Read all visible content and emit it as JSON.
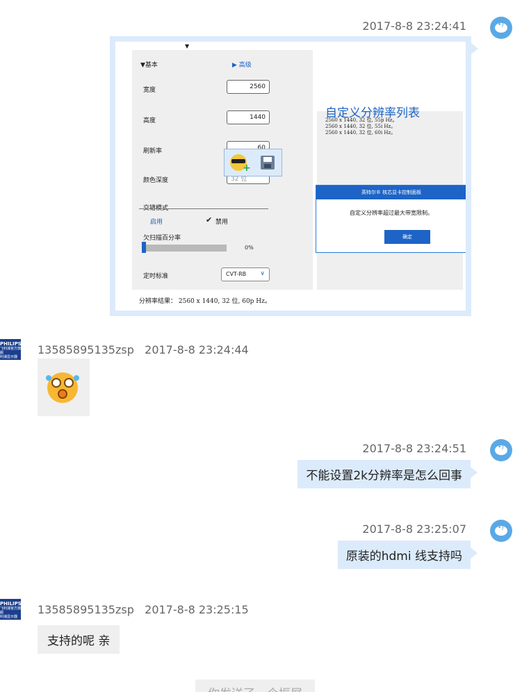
{
  "messages": [
    {
      "time": "2017-8-8 23:24:41"
    },
    {
      "sender": "13585895135zsp",
      "time": "2017-8-8 23:24:44"
    },
    {
      "time": "2017-8-8 23:24:51",
      "text": "不能设置2k分辨率是怎么回事"
    },
    {
      "time": "2017-8-8 23:25:07",
      "text": "原装的hdmi 线支持吗"
    },
    {
      "sender": "13585895135zsp",
      "time": "2017-8-8 23:25:15",
      "text": "支持的呢 亲"
    }
  ],
  "other_avatar": {
    "brand": "PHILIPS",
    "line1": "飞利浦官方旗舰",
    "line2": "利浦显示器"
  },
  "screenshot": {
    "tab_basic": "基本",
    "tab_advanced": "高级",
    "width_label": "宽度",
    "width_value": "2560",
    "height_label": "高度",
    "height_value": "1440",
    "refresh_label": "刷新率",
    "refresh_value": "60",
    "color_depth_label": "颜色深度",
    "color_depth_value": "32 位",
    "interlace_label": "交错模式",
    "interlace_on": "启用",
    "interlace_off": "禁用",
    "underscan_label": "欠扫描百分率",
    "underscan_value": "0%",
    "timing_label": "定时标准",
    "timing_value": "CVT-RB",
    "result": "分辨率结果： 2560 x 1440, 32 位, 60p Hz。",
    "list_title": "自定义分辨率列表",
    "list_items": [
      "2560 x 1440, 32 位, 55p Hz。",
      "2560 x 1440, 32 位, 55i Hz。",
      "2560 x 1440, 32 位, 60i Hz。"
    ],
    "dialog_title": "英特尔® 核芯显卡控制面板",
    "dialog_message": "自定义分辨率超过最大带宽限制。",
    "dialog_ok": "确定"
  },
  "shake_notice": "你发送了一个振屏",
  "colors": {
    "my_bubble": "#dcebfb",
    "other_bubble": "#efefef",
    "accent": "#1d64c6"
  }
}
